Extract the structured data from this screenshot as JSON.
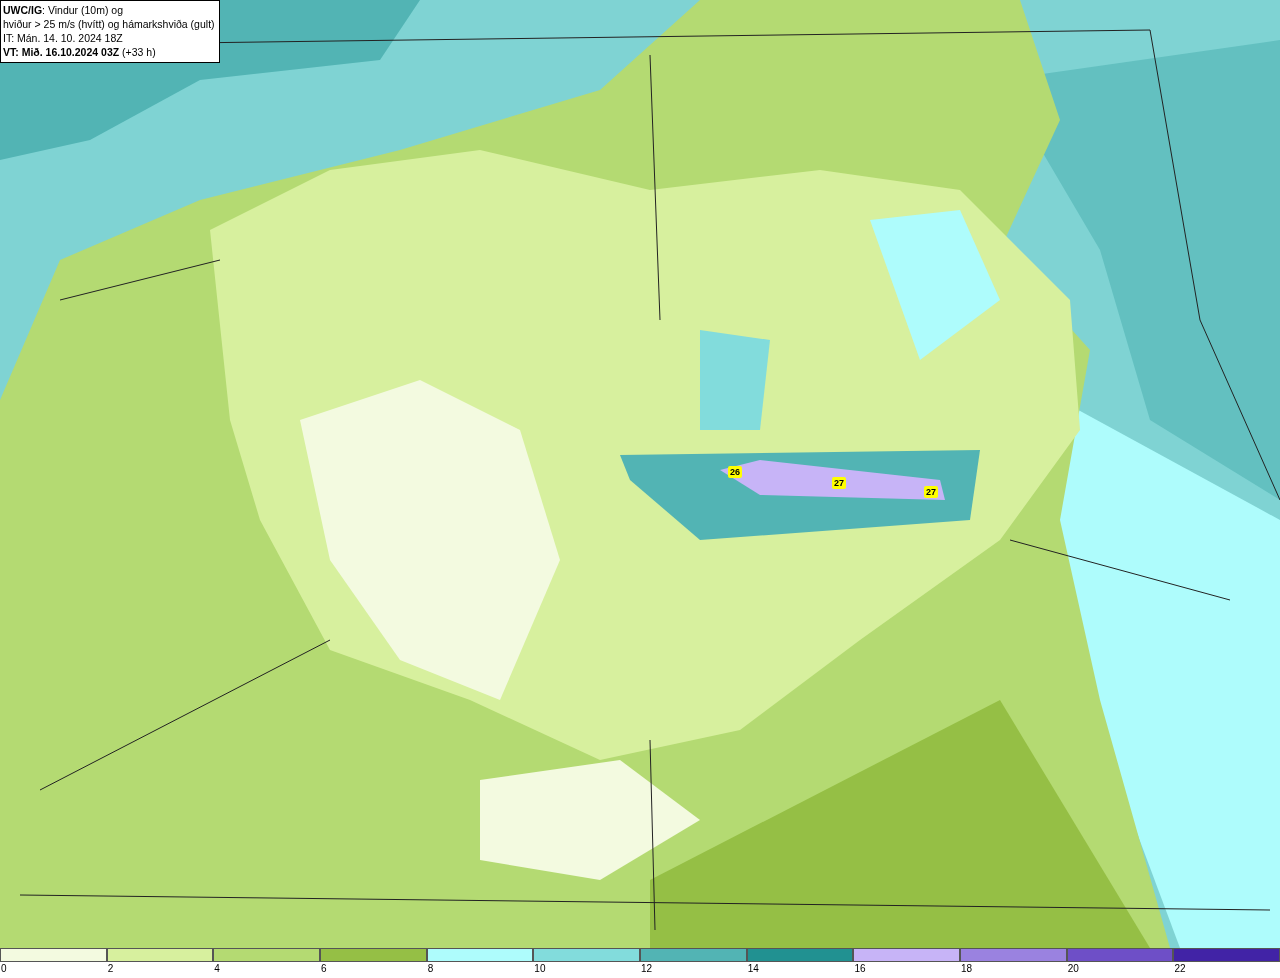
{
  "legend": {
    "lines": [
      "**UWC/IG**: Vindur (10m) og",
      "hviður > 25 m/s (hvítt) og hámarkshviða (gult)",
      "IT: Mán. 14. 10. 2024 18Z",
      "**VT: Mið. 16.10.2024 03Z** (+33 h)"
    ]
  },
  "map": {
    "gust_labels": [
      "26",
      "27",
      "27"
    ]
  },
  "colorbar": {
    "bins": [
      {
        "label": "0",
        "color": "#f3fae0"
      },
      {
        "label": "2",
        "color": "#d7f09e"
      },
      {
        "label": "4",
        "color": "#b4da72"
      },
      {
        "label": "6",
        "color": "#95bf45"
      },
      {
        "label": "8",
        "color": "#aefcfc"
      },
      {
        "label": "10",
        "color": "#82dcdc"
      },
      {
        "label": "12",
        "color": "#52b4b4"
      },
      {
        "label": "14",
        "color": "#219191"
      },
      {
        "label": "16",
        "color": "#c7b4f7"
      },
      {
        "label": "18",
        "color": "#9a82e0"
      },
      {
        "label": "20",
        "color": "#6e4fc7"
      },
      {
        "label": "22",
        "color": "#4123a6"
      }
    ]
  }
}
